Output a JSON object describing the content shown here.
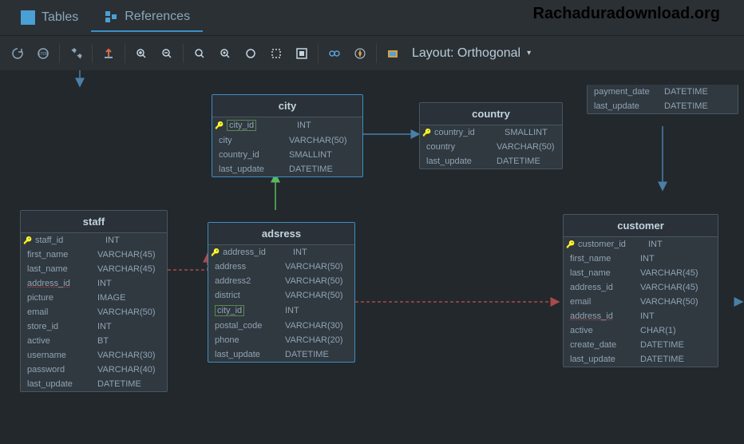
{
  "watermark": "Rachaduradownload.org",
  "tabs": {
    "tables": "Tables",
    "references": "References"
  },
  "toolbar": {
    "layout_label": "Layout: Orthogonal"
  },
  "entities": {
    "city": {
      "title": "city",
      "cols": [
        {
          "name": "city_id",
          "type": "INT"
        },
        {
          "name": "city",
          "type": "VARCHAR(50)"
        },
        {
          "name": "country_id",
          "type": "SMALLINT"
        },
        {
          "name": "last_update",
          "type": "DATETIME"
        }
      ]
    },
    "country": {
      "title": "country",
      "cols": [
        {
          "name": "country_id",
          "type": "SMALLINT"
        },
        {
          "name": "country",
          "type": "VARCHAR(50)"
        },
        {
          "name": "last_update",
          "type": "DATETIME"
        }
      ]
    },
    "staff": {
      "title": "staff",
      "cols": [
        {
          "name": "staff_id",
          "type": "INT"
        },
        {
          "name": "first_name",
          "type": "VARCHAR(45)"
        },
        {
          "name": "last_name",
          "type": "VARCHAR(45)"
        },
        {
          "name": "address_id",
          "type": "INT"
        },
        {
          "name": "picture",
          "type": "IMAGE"
        },
        {
          "name": "email",
          "type": "VARCHAR(50)"
        },
        {
          "name": "store_id",
          "type": "INT"
        },
        {
          "name": "active",
          "type": "BT"
        },
        {
          "name": "username",
          "type": "VARCHAR(30)"
        },
        {
          "name": "password",
          "type": "VARCHAR(40)"
        },
        {
          "name": "last_update",
          "type": "DATETIME"
        }
      ]
    },
    "adsress": {
      "title": "adsress",
      "cols": [
        {
          "name": "address_id",
          "type": "INT"
        },
        {
          "name": "address",
          "type": "VARCHAR(50)"
        },
        {
          "name": "address2",
          "type": "VARCHAR(50)"
        },
        {
          "name": "district",
          "type": "VARCHAR(50)"
        },
        {
          "name": "city_id",
          "type": "INT"
        },
        {
          "name": "postal_code",
          "type": "VARCHAR(30)"
        },
        {
          "name": "phone",
          "type": "VARCHAR(20)"
        },
        {
          "name": "last_update",
          "type": "DATETIME"
        }
      ]
    },
    "customer": {
      "title": "customer",
      "cols": [
        {
          "name": "customer_id",
          "type": "INT"
        },
        {
          "name": "first_name",
          "type": "INT"
        },
        {
          "name": "last_name",
          "type": "VARCHAR(45)"
        },
        {
          "name": "address_id",
          "type": "VARCHAR(45)"
        },
        {
          "name": "email",
          "type": "VARCHAR(50)"
        },
        {
          "name": "address_id",
          "type": "INT"
        },
        {
          "name": "active",
          "type": "CHAR(1)"
        },
        {
          "name": "create_date",
          "type": "DATETIME"
        },
        {
          "name": "last_update",
          "type": "DATETIME"
        }
      ]
    },
    "payment_fragment": {
      "cols": [
        {
          "name": "payment_date",
          "type": "DATETIME"
        },
        {
          "name": "last_update",
          "type": "DATETIME"
        }
      ]
    }
  }
}
